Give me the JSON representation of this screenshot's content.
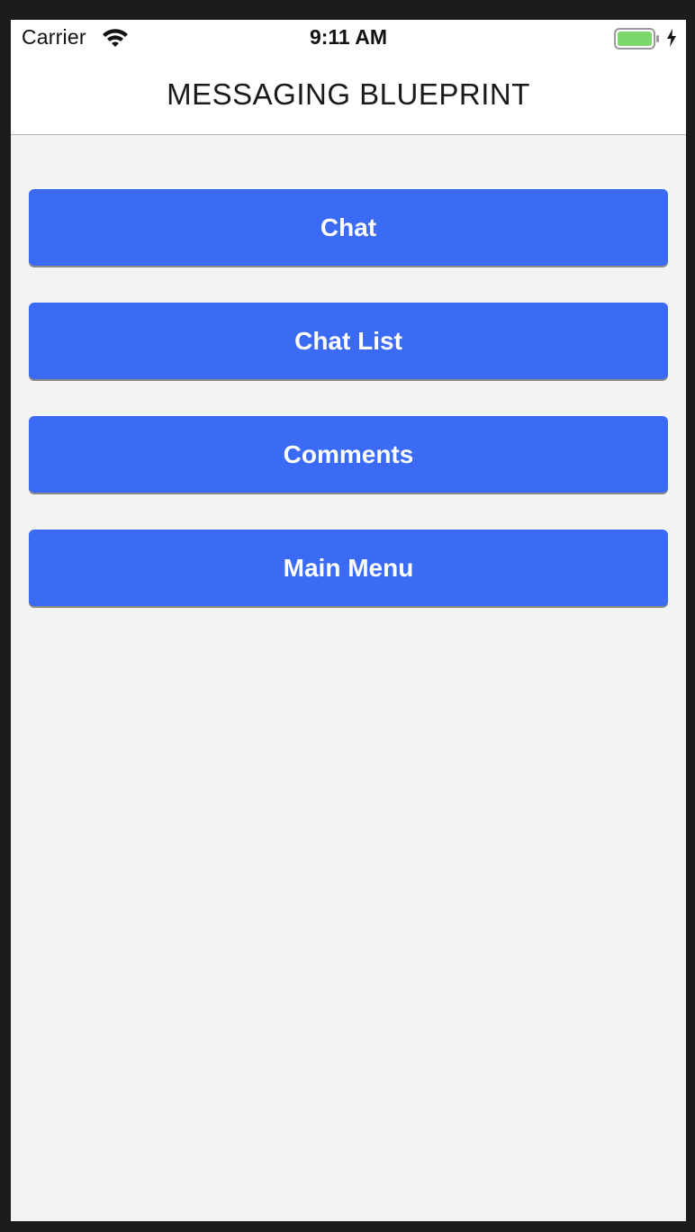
{
  "status_bar": {
    "carrier": "Carrier",
    "time": "9:11 AM",
    "wifi_icon": "wifi-icon",
    "battery_icon": "battery-icon",
    "charging_icon": "charging-bolt-icon",
    "battery_color": "#7bd86a"
  },
  "nav": {
    "title": "MESSAGING BLUEPRINT"
  },
  "menu": {
    "button_color": "#3b6bf5",
    "items": [
      {
        "label": "Chat"
      },
      {
        "label": "Chat List"
      },
      {
        "label": "Comments"
      },
      {
        "label": "Main Menu"
      }
    ]
  }
}
